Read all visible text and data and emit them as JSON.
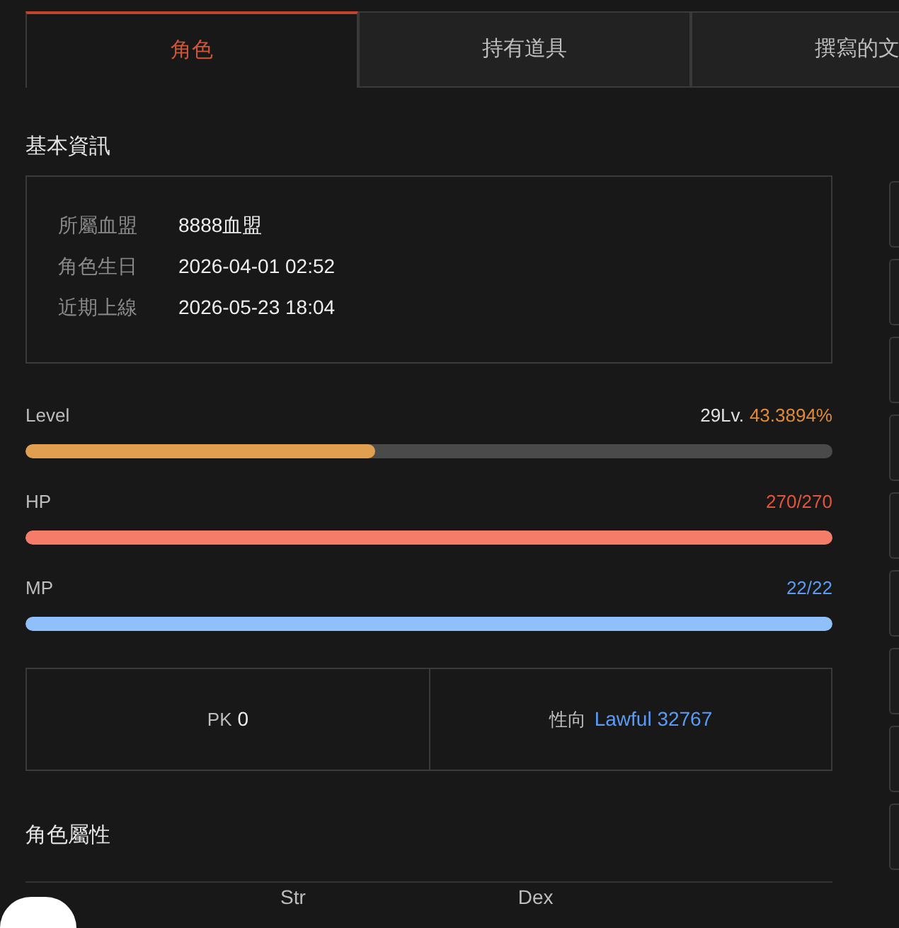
{
  "tabs": [
    {
      "label": "角色",
      "selected": true
    },
    {
      "label": "持有道具",
      "selected": false
    },
    {
      "label": "撰寫的文",
      "selected": false
    }
  ],
  "basic_info": {
    "heading": "基本資訊",
    "rows": [
      {
        "label": "所屬血盟",
        "value": "8888血盟"
      },
      {
        "label": "角色生日",
        "value": "2026-04-01 02:52"
      },
      {
        "label": "近期上線",
        "value": "2026-05-23 18:04"
      }
    ]
  },
  "bars": [
    {
      "kind": "level",
      "label": "Level",
      "reading": "29Lv.",
      "percent": "43.3894%",
      "level": 0.434
    },
    {
      "kind": "hp",
      "label": "HP",
      "reading": "270/270",
      "level": 1
    },
    {
      "kind": "mp",
      "label": "MP",
      "reading": "22/22",
      "level": 1
    }
  ],
  "stats": {
    "pk_label": "PK",
    "pk_value": "0",
    "alignment_label": "性向",
    "alignment_value": "Lawful 32767"
  },
  "attributes": {
    "heading": "角色屬性",
    "columns": [
      "Str",
      "Dex"
    ]
  }
}
